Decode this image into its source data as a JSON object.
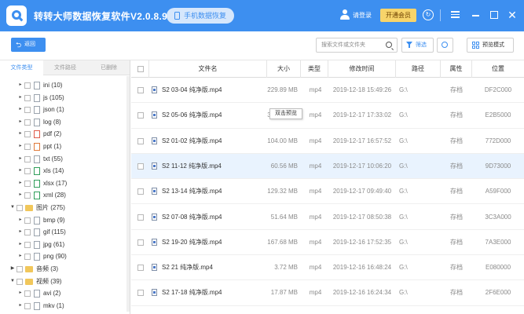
{
  "app": {
    "title": "转转大师数据恢复软件V2.0.8.9",
    "phone_recovery_label": "手机数据恢复",
    "login_label": "请登录",
    "vip_label": "开通会员",
    "accent_color": "#3d8ff0"
  },
  "toolbar": {
    "back_label": "返回",
    "search_placeholder": "搜索文件或文件夹",
    "filter_label": "筛选",
    "preview_mode_label": "预览模式"
  },
  "sidebar": {
    "tabs": [
      {
        "label": "文件类型",
        "active": true
      },
      {
        "label": "文件路径",
        "active": false
      },
      {
        "label": "已删除",
        "active": false
      }
    ],
    "tree": [
      {
        "label": "ini (10)",
        "level": 2,
        "type": "file"
      },
      {
        "label": "js (105)",
        "level": 2,
        "type": "file"
      },
      {
        "label": "json (1)",
        "level": 2,
        "type": "file"
      },
      {
        "label": "log (8)",
        "level": 2,
        "type": "file"
      },
      {
        "label": "pdf (2)",
        "level": 2,
        "type": "file"
      },
      {
        "label": "ppt (1)",
        "level": 2,
        "type": "file"
      },
      {
        "label": "txt (55)",
        "level": 2,
        "type": "file"
      },
      {
        "label": "xls (14)",
        "level": 2,
        "type": "file"
      },
      {
        "label": "xlsx (17)",
        "level": 2,
        "type": "file"
      },
      {
        "label": "xml (28)",
        "level": 2,
        "type": "file"
      },
      {
        "label": "图片 (275)",
        "level": 1,
        "type": "folder",
        "expanded": true
      },
      {
        "label": "bmp (9)",
        "level": 2,
        "type": "file"
      },
      {
        "label": "gif (115)",
        "level": 2,
        "type": "file"
      },
      {
        "label": "jpg (61)",
        "level": 2,
        "type": "file"
      },
      {
        "label": "png (90)",
        "level": 2,
        "type": "file"
      },
      {
        "label": "音频 (3)",
        "level": 1,
        "type": "folder",
        "expanded": false
      },
      {
        "label": "视频 (39)",
        "level": 1,
        "type": "folder",
        "expanded": true
      },
      {
        "label": "avi (2)",
        "level": 2,
        "type": "file"
      },
      {
        "label": "mkv (1)",
        "level": 2,
        "type": "file"
      }
    ]
  },
  "table": {
    "columns": [
      "文件名",
      "大小",
      "类型",
      "修改时间",
      "路径",
      "属性",
      "位置"
    ],
    "rows": [
      {
        "name": "S2 03-04 纯净版.mp4",
        "size": "229.89 MB",
        "type": "mp4",
        "modified": "2019-12-18 15:49:26",
        "path": "G:\\",
        "attr": "存档",
        "pos": "DF2C000"
      },
      {
        "name": "S2 05-06 纯净版.mp4",
        "size": "345.54 MB",
        "type": "mp4",
        "modified": "2019-12-17 17:33:02",
        "path": "G:\\",
        "attr": "存档",
        "pos": "E2B5000"
      },
      {
        "name": "S2 01-02 纯净版.mp4",
        "size": "104.00 MB",
        "type": "mp4",
        "modified": "2019-12-17 16:57:52",
        "path": "G:\\",
        "attr": "存档",
        "pos": "772D000"
      },
      {
        "name": "S2 11-12 纯净版.mp4",
        "size": "60.56 MB",
        "type": "mp4",
        "modified": "2019-12-17 10:06:20",
        "path": "G:\\",
        "attr": "存档",
        "pos": "9D73000"
      },
      {
        "name": "S2 13-14 纯净版.mp4",
        "size": "129.32 MB",
        "type": "mp4",
        "modified": "2019-12-17 09:49:40",
        "path": "G:\\",
        "attr": "存档",
        "pos": "A59F000"
      },
      {
        "name": "S2 07-08 纯净版.mp4",
        "size": "51.64 MB",
        "type": "mp4",
        "modified": "2019-12-17 08:50:38",
        "path": "G:\\",
        "attr": "存档",
        "pos": "3C3A000"
      },
      {
        "name": "S2 19-20 纯净版.mp4",
        "size": "167.68 MB",
        "type": "mp4",
        "modified": "2019-12-16 17:52:35",
        "path": "G:\\",
        "attr": "存档",
        "pos": "7A3E000"
      },
      {
        "name": "S2 21 纯净版.mp4",
        "size": "3.72 MB",
        "type": "mp4",
        "modified": "2019-12-16 16:48:24",
        "path": "G:\\",
        "attr": "存档",
        "pos": "E080000"
      },
      {
        "name": "S2 17-18 纯净版.mp4",
        "size": "17.87 MB",
        "type": "mp4",
        "modified": "2019-12-16 16:24:34",
        "path": "G:\\",
        "attr": "存档",
        "pos": "2F6E000"
      }
    ],
    "tooltip": "双击预览"
  }
}
